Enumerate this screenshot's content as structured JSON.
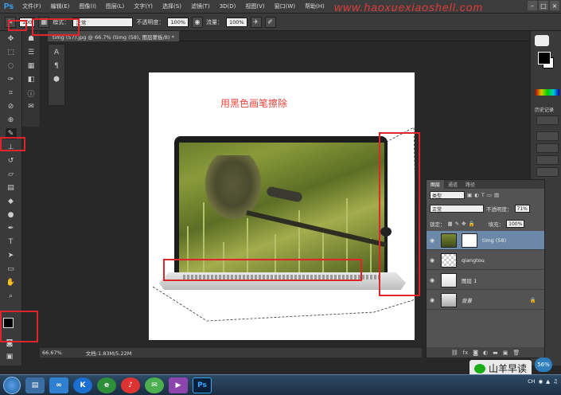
{
  "app": {
    "logo": "Ps",
    "menu": [
      "文件(F)",
      "编辑(E)",
      "图像(I)",
      "图层(L)",
      "文字(Y)",
      "选择(S)",
      "滤镜(T)",
      "3D(D)",
      "视图(V)",
      "窗口(W)",
      "帮助(H)"
    ],
    "watermark": "www.haoxuexiaoshell.com"
  },
  "options": {
    "brush_size": "100",
    "mode_label": "模式：",
    "mode_value": "正常",
    "opacity_label": "不透明度：",
    "opacity_value": "100%",
    "flow_label": "流量：",
    "flow_value": "100%"
  },
  "document": {
    "tab_title": "timg (57).jpg @ 66.7% (timg (58), 图层蒙板/8) *",
    "annotation": "用黑色画笔擦除"
  },
  "history": {
    "label": "历史记录"
  },
  "layers_panel": {
    "tabs": [
      "图层",
      "通道",
      "路径"
    ],
    "filter_kind": "类型",
    "blend_mode": "正常",
    "opacity_label": "不透明度：",
    "opacity_value": "71%",
    "lock_label": "锁定：",
    "fill_label": "填充：",
    "fill_value": "100%",
    "layers": [
      {
        "name": "timg (58)",
        "selected": true
      },
      {
        "name": "qiangtou",
        "selected": false
      },
      {
        "name": "图层 1",
        "selected": false
      },
      {
        "name": "背景",
        "selected": false
      }
    ]
  },
  "status": {
    "zoom": "66.67%",
    "doc_info": "文档:1.83M/5.22M"
  },
  "overlay": {
    "wechat_name": "山羊早读",
    "badge": "56%"
  },
  "taskbar": {
    "tray_text": "CH"
  }
}
